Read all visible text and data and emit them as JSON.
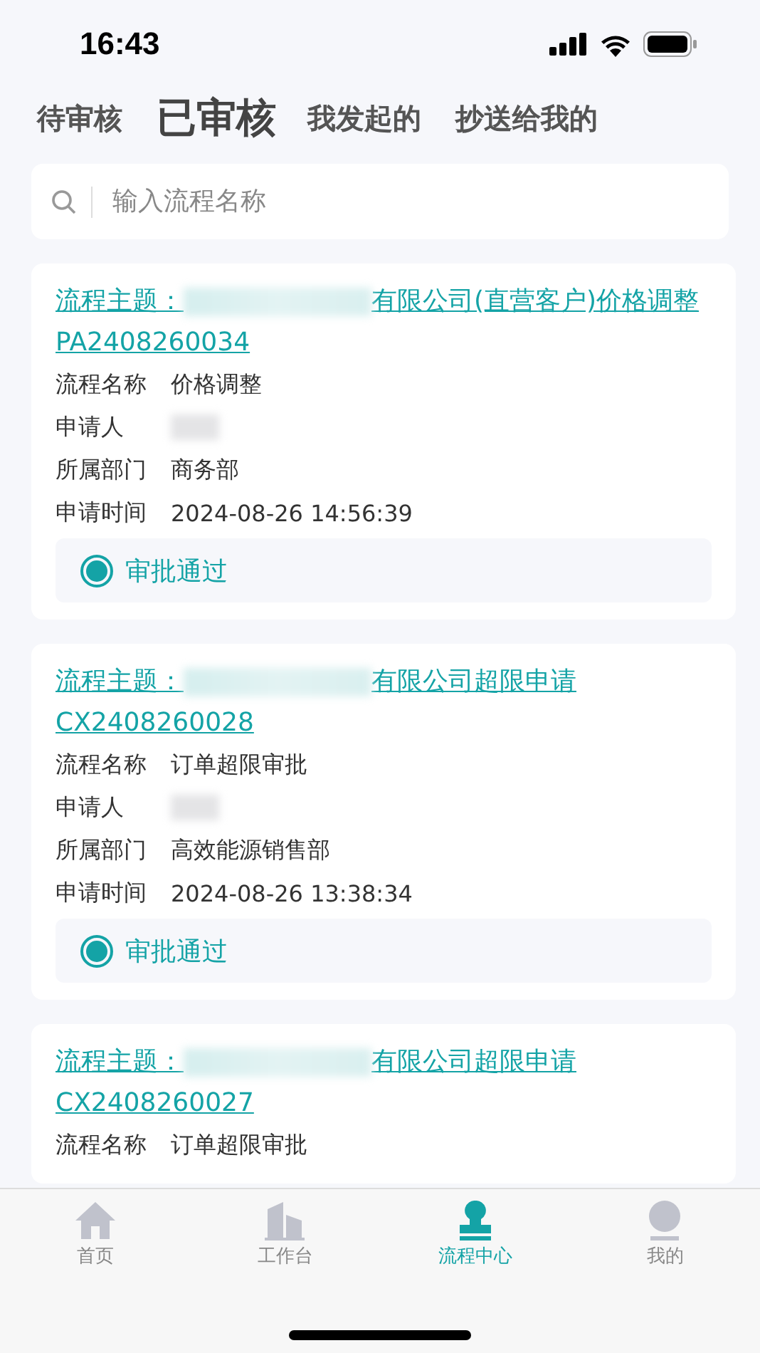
{
  "status_bar": {
    "time": "16:43"
  },
  "tabs": [
    {
      "label": "待审核",
      "selected": false
    },
    {
      "label": "已审核",
      "selected": true
    },
    {
      "label": "我发起的",
      "selected": false
    },
    {
      "label": "抄送给我的",
      "selected": false
    }
  ],
  "search": {
    "placeholder": "输入流程名称"
  },
  "cards": [
    {
      "title": {
        "prefix": "流程主题：",
        "redacted": true,
        "suffix": "有限公司(直营客户)价格调整PA2408260034"
      },
      "fields": [
        {
          "label": "流程名称",
          "value": "价格调整"
        },
        {
          "label": "申请人",
          "redacted": true
        },
        {
          "label": "所属部门",
          "value": "商务部"
        },
        {
          "label": "申请时间",
          "value": "2024-08-26 14:56:39"
        }
      ],
      "status": "审批通过"
    },
    {
      "title": {
        "prefix": "流程主题：",
        "redacted": true,
        "suffix": "有限公司超限申请CX2408260028"
      },
      "fields": [
        {
          "label": "流程名称",
          "value": "订单超限审批"
        },
        {
          "label": "申请人",
          "redacted": true
        },
        {
          "label": "所属部门",
          "value": "高效能源销售部"
        },
        {
          "label": "申请时间",
          "value": "2024-08-26 13:38:34"
        }
      ],
      "status": "审批通过"
    },
    {
      "title": {
        "prefix": "流程主题：",
        "redacted": true,
        "suffix": "有限公司超限申请CX2408260027"
      },
      "fields": [
        {
          "label": "流程名称",
          "value": "订单超限审批"
        }
      ]
    }
  ],
  "nav": [
    {
      "label": "首页",
      "kind": "home",
      "selected": false
    },
    {
      "label": "工作台",
      "kind": "buildings",
      "selected": false
    },
    {
      "label": "流程中心",
      "kind": "stamp",
      "selected": true
    },
    {
      "label": "我的",
      "kind": "person",
      "selected": false
    }
  ]
}
